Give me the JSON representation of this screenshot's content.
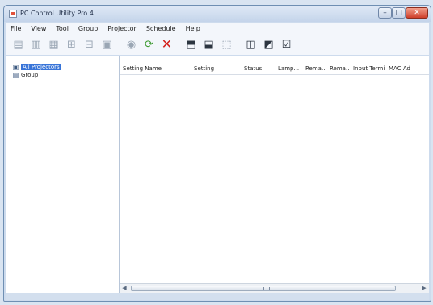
{
  "window": {
    "title": "PC Control Utility Pro 4",
    "controls": [
      "–",
      "□",
      "✕"
    ]
  },
  "menu": [
    "File",
    "View",
    "Tool",
    "Group",
    "Projector",
    "Schedule",
    "Help"
  ],
  "toolbar": {
    "buttons": [
      {
        "icon": "projector-add-icon",
        "glyph": "▤",
        "state": "disabled"
      },
      {
        "icon": "projector-remove-icon",
        "glyph": "▥",
        "state": "disabled"
      },
      {
        "icon": "network-icon",
        "glyph": "▦",
        "state": "disabled"
      },
      {
        "icon": "group-add-icon",
        "glyph": "⊞",
        "state": "disabled"
      },
      {
        "icon": "group-edit-icon",
        "glyph": "⊟",
        "state": "disabled"
      },
      {
        "icon": "group-remove-icon",
        "glyph": "▣",
        "state": "disabled"
      },
      {
        "icon": "info-icon",
        "glyph": "◉",
        "state": "disabled"
      },
      {
        "icon": "refresh-icon",
        "glyph": "⟳",
        "state": "green"
      },
      {
        "icon": "delete-icon",
        "glyph": "✕",
        "state": "red"
      },
      {
        "icon": "export-icon",
        "glyph": "⬒",
        "state": "dark"
      },
      {
        "icon": "import-icon",
        "glyph": "⬓",
        "state": "dark"
      },
      {
        "icon": "copy-icon",
        "glyph": "⬚",
        "state": "disabled"
      },
      {
        "icon": "schedule-icon",
        "glyph": "◫",
        "state": "dark"
      },
      {
        "icon": "camera-icon",
        "glyph": "◩",
        "state": "dark"
      },
      {
        "icon": "check-icon",
        "glyph": "☑",
        "state": "dark"
      }
    ]
  },
  "tree": {
    "items": [
      {
        "label": "All Projectors",
        "selected": true
      },
      {
        "label": "Group",
        "selected": false
      }
    ]
  },
  "table": {
    "columns": [
      {
        "label": "Setting Name",
        "width": 84
      },
      {
        "label": "Setting",
        "width": 58
      },
      {
        "label": "Status",
        "width": 38
      },
      {
        "label": "Lamp...",
        "width": 30
      },
      {
        "label": "Rema...",
        "width": 26
      },
      {
        "label": "Rema...",
        "width": 25
      },
      {
        "label": "Input Termi...",
        "width": 40
      },
      {
        "label": "MAC Ad",
        "width": 30
      }
    ]
  }
}
